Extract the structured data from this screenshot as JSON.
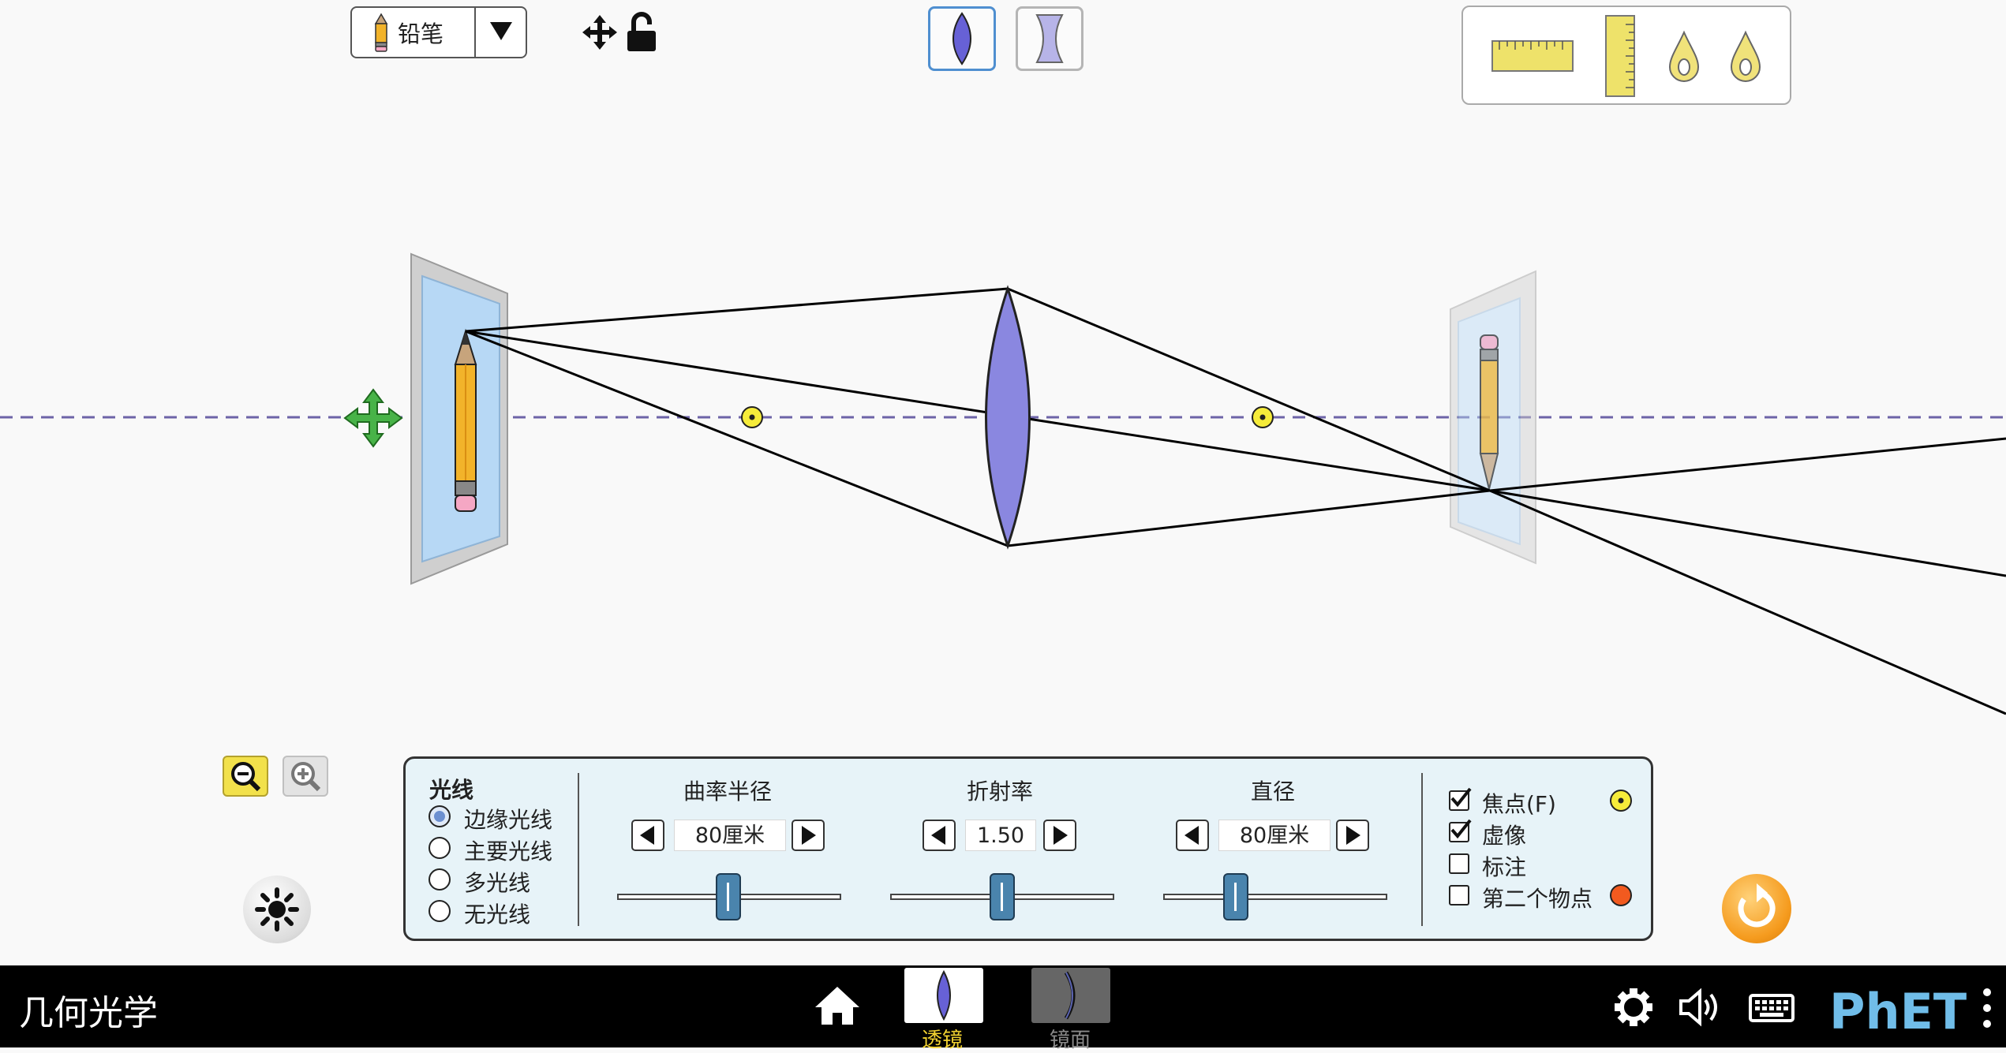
{
  "app": {
    "title": "几何光学"
  },
  "object_selector": {
    "selected": "铅笔",
    "icon": "pencil-icon"
  },
  "toolbar": {
    "drag_icon": "move-icon",
    "lock_icon": "unlock-icon"
  },
  "lens_type": {
    "options": [
      "convex-lens",
      "concave-lens"
    ],
    "selected": "convex-lens"
  },
  "toolbox": {
    "items": [
      "ruler-horizontal-icon",
      "ruler-vertical-icon",
      "position-marker-icon",
      "position-marker-icon"
    ]
  },
  "zoom": {
    "out_icon": "zoom-out-icon",
    "in_icon": "zoom-in-icon"
  },
  "rays": {
    "title": "光线",
    "options": [
      {
        "label": "边缘光线",
        "selected": true
      },
      {
        "label": "主要光线",
        "selected": false
      },
      {
        "label": "多光线",
        "selected": false
      },
      {
        "label": "无光线",
        "selected": false
      }
    ]
  },
  "controls": {
    "radius": {
      "label": "曲率半径",
      "value": "80厘米",
      "slider_fraction": 0.5
    },
    "index": {
      "label": "折射率",
      "value": "1.50",
      "slider_fraction": 0.5
    },
    "diameter": {
      "label": "直径",
      "value": "80厘米",
      "slider_fraction": 0.33
    }
  },
  "checkboxes": [
    {
      "label": "焦点(F)",
      "checked": true,
      "marker": "focal-point-icon"
    },
    {
      "label": "虚像",
      "checked": true
    },
    {
      "label": "标注",
      "checked": false
    },
    {
      "label": "第二个物点",
      "checked": false,
      "marker": "second-point-icon"
    }
  ],
  "colors": {
    "accent": "#4f8fd0",
    "focal": "#f6ec3a",
    "second_point": "#f25a1f",
    "lens": "#8a87e0",
    "active_tab": "#f2d230"
  },
  "nav": {
    "tabs": [
      {
        "label": "透镜",
        "active": true
      },
      {
        "label": "镜面",
        "active": false
      }
    ],
    "brand": "PhET"
  }
}
